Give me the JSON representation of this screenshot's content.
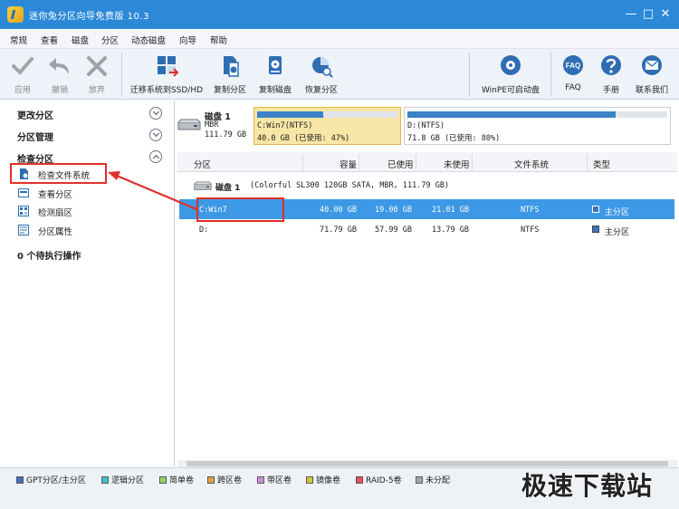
{
  "window": {
    "title": "迷你兔分区向导免费版 10.3",
    "minimize_glyph": "—",
    "maximize_glyph": "□",
    "close_glyph": "✕"
  },
  "menu": [
    "常规",
    "查看",
    "磁盘",
    "分区",
    "动态磁盘",
    "向导",
    "帮助"
  ],
  "toolbar": {
    "apply": "应用",
    "undo": "撤销",
    "discard": "放弃",
    "migrate": "迁移系统到SSD/HD",
    "copy_partition": "复制分区",
    "copy_disk": "复制磁盘",
    "restore_partition": "恢复分区",
    "winpe": "WinPE可启动盘",
    "faq_icon_text": "FAQ",
    "faq": "FAQ",
    "manual": "手册",
    "contact": "联系我们"
  },
  "sidebar": {
    "sections": {
      "change_partition": "更改分区",
      "partition_management": "分区管理",
      "check_partition": "检查分区"
    },
    "check_items": [
      "检查文件系统",
      "查看分区",
      "检测扇区",
      "分区属性"
    ],
    "pending_ops": "0 个待执行操作"
  },
  "disk_card": {
    "name": "磁盘 1",
    "style": "MBR",
    "size": "111.79 GB",
    "partitions": [
      {
        "label": "C:Win7(NTFS)",
        "detail": "40.0 GB (已使用: 47%)",
        "used_pct": 47,
        "selected": true
      },
      {
        "label": "D:(NTFS)",
        "detail": "71.8 GB (已使用: 80%)",
        "used_pct": 80,
        "selected": false
      }
    ]
  },
  "table": {
    "headers": [
      "分区",
      "容量",
      "已使用",
      "未使用",
      "文件系统",
      "类型"
    ],
    "disk_header": {
      "name": "磁盘 1",
      "detail": "(Colorful SL300 120GB SATA, MBR, 111.79 GB)"
    },
    "rows": [
      {
        "partition": "C:Win7",
        "capacity": "40.00 GB",
        "used": "19.00 GB",
        "unused": "21.01 GB",
        "fs": "NTFS",
        "type": "主分区",
        "selected": true
      },
      {
        "partition": "D:",
        "capacity": "71.79 GB",
        "used": "57.99 GB",
        "unused": "13.79 GB",
        "fs": "NTFS",
        "type": "主分区",
        "selected": false
      }
    ]
  },
  "legend": [
    {
      "label": "GPT分区/主分区",
      "color": "#3b73b9"
    },
    {
      "label": "逻辑分区",
      "color": "#41c4d8"
    },
    {
      "label": "简单卷",
      "color": "#9bd36a"
    },
    {
      "label": "跨区卷",
      "color": "#e3a050"
    },
    {
      "label": "带区卷",
      "color": "#cf8fd6"
    },
    {
      "label": "镜像卷",
      "color": "#d8c43a"
    },
    {
      "label": "RAID-5卷",
      "color": "#e8555a"
    },
    {
      "label": "未分配",
      "color": "#a8a8a8"
    }
  ],
  "watermark": "极速下载站",
  "colors": {
    "title_bar": "#2b89d8",
    "selection": "#3d98e6",
    "used_bar": "#3b82c6",
    "callout": "#e0302c"
  }
}
